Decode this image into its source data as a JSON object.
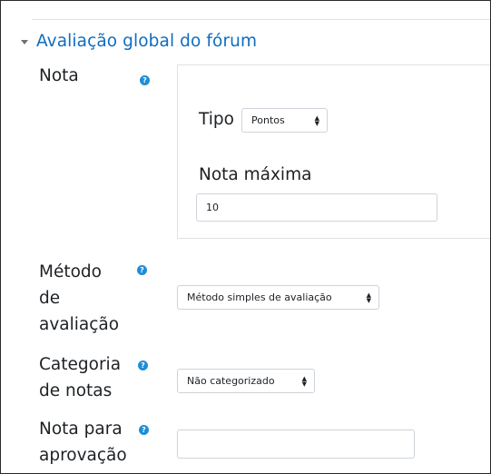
{
  "section": {
    "title": "Avaliação global do fórum"
  },
  "fields": {
    "grade": {
      "label": "Nota",
      "type_label": "Tipo",
      "type_value": "Pontos",
      "max_label": "Nota máxima",
      "max_value": "10"
    },
    "method": {
      "label_lines": [
        "Método",
        "de",
        "avaliação"
      ],
      "value": "Método simples de avaliação"
    },
    "category": {
      "label_lines": [
        "Categoria",
        "de notas"
      ],
      "value": "Não categorizado"
    },
    "pass": {
      "label_lines": [
        "Nota para",
        "aprovação"
      ],
      "value": ""
    }
  },
  "icons": {
    "help": "question-circle-icon",
    "caret": "caret-down-icon"
  },
  "colors": {
    "link": "#0f6cbf",
    "help_icon": "#1f8dd6",
    "border": "#ced4da"
  }
}
